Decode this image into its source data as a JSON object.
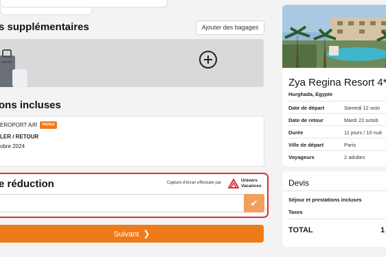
{
  "options": {
    "title": "s supplémentaires",
    "add_bags_label": "Ajouter des bagages"
  },
  "inclusions": {
    "title": "ons incluses",
    "line1": "EROPORT A/R",
    "badge": "Inclus",
    "line2": "LER / RETOUR",
    "line3": "obre 2024"
  },
  "promo": {
    "title": "e réduction",
    "capture_note": "Capture d'écran effectuée par",
    "brand_line1": "Univers",
    "brand_line2": "Vacances",
    "input_value": "",
    "ok_glyph": "✔"
  },
  "next_button": {
    "label": "Suivant",
    "chevron": "❯"
  },
  "hotel": {
    "name": "Zya Regina Resort 4*",
    "location": "Hurghada, Egypte",
    "rows": [
      {
        "label": "Date de départ",
        "value": "Samedi 12 octo"
      },
      {
        "label": "Date de retour",
        "value": "Mardi 22 octob"
      },
      {
        "label": "Durée",
        "value": "11 jours / 10 nuit"
      },
      {
        "label": "Ville de départ",
        "value": "Paris"
      },
      {
        "label": "Voyageurs",
        "value": "2 adultes"
      }
    ]
  },
  "devis": {
    "title": "Devis",
    "line1": "Séjour et prestations incluses",
    "line2": "Taxes",
    "total_label": "TOTAL",
    "total_value": "1"
  },
  "colors": {
    "accent": "#ef7a1a",
    "promo_border": "#d4303a",
    "background": "#f3f3f3"
  }
}
